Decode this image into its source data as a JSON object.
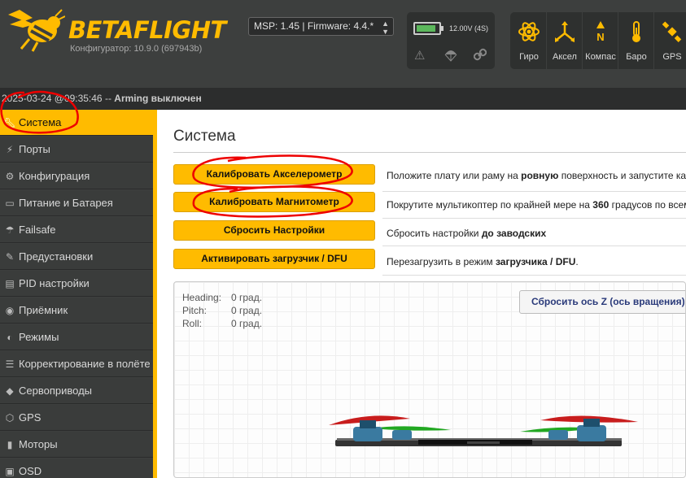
{
  "header": {
    "logo_text": "BETAFLIGHT",
    "configurator_version": "Конфигуратор: 10.9.0 (697943b)",
    "msp_firmware": "MSP: 1.45 | Firmware: 4.4.*",
    "voltage": "12.00V (4S)",
    "sensors": [
      {
        "label": "Гиро",
        "icon": "gyro-icon"
      },
      {
        "label": "Аксел",
        "icon": "accel-icon"
      },
      {
        "label": "Компас",
        "icon": "compass-icon"
      },
      {
        "label": "Баро",
        "icon": "baro-icon"
      },
      {
        "label": "GPS",
        "icon": "gps-icon"
      }
    ],
    "accent_color": "#ffbb00"
  },
  "statusbar": {
    "datetime": "2025-03-24 @09:35:46 -- ",
    "arming_label": "Arming",
    "arming_state": " выключен"
  },
  "sidebar": {
    "items": [
      {
        "label": "Система",
        "icon": "wrench-icon"
      },
      {
        "label": "Порты",
        "icon": "plug-icon"
      },
      {
        "label": "Конфигурация",
        "icon": "gear-icon"
      },
      {
        "label": "Питание и Батарея",
        "icon": "battery-icon"
      },
      {
        "label": "Failsafe",
        "icon": "parachute-icon"
      },
      {
        "label": "Предустановки",
        "icon": "presets-icon"
      },
      {
        "label": "PID настройки",
        "icon": "pid-icon"
      },
      {
        "label": "Приёмник",
        "icon": "receiver-icon"
      },
      {
        "label": "Режимы",
        "icon": "modes-icon"
      },
      {
        "label": "Корректирование в полёте",
        "icon": "sliders-icon"
      },
      {
        "label": "Сервоприводы",
        "icon": "servo-icon"
      },
      {
        "label": "GPS",
        "icon": "gps-pin-icon"
      },
      {
        "label": "Моторы",
        "icon": "motor-icon"
      },
      {
        "label": "OSD",
        "icon": "osd-icon"
      }
    ]
  },
  "main": {
    "title": "Система",
    "actions": [
      {
        "button": "Калибровать Акселерометр",
        "desc_pre": "Положите плату или раму на ",
        "desc_bold": "ровную",
        "desc_post": " поверхность и запустите калибровку"
      },
      {
        "button": "Калибровать Магнитометр",
        "desc_pre": "Покрутите мультикоптер по крайней мере на ",
        "desc_bold": "360",
        "desc_post": " градусов по всем осям"
      },
      {
        "button": "Сбросить Настройки",
        "desc_pre": "Сбросить настройки ",
        "desc_bold": "до заводских",
        "desc_post": ""
      },
      {
        "button": "Активировать загрузчик / DFU",
        "desc_pre": "Перезагрузить в режим ",
        "desc_bold": "загрузчика / DFU",
        "desc_post": "."
      }
    ],
    "attitude": [
      {
        "label": "Heading:",
        "value": "0 град."
      },
      {
        "label": "Pitch:",
        "value": "0 град."
      },
      {
        "label": "Roll:",
        "value": "0 град."
      }
    ],
    "reset_z_button": "Сбросить ось Z (ось вращения), смещение"
  }
}
